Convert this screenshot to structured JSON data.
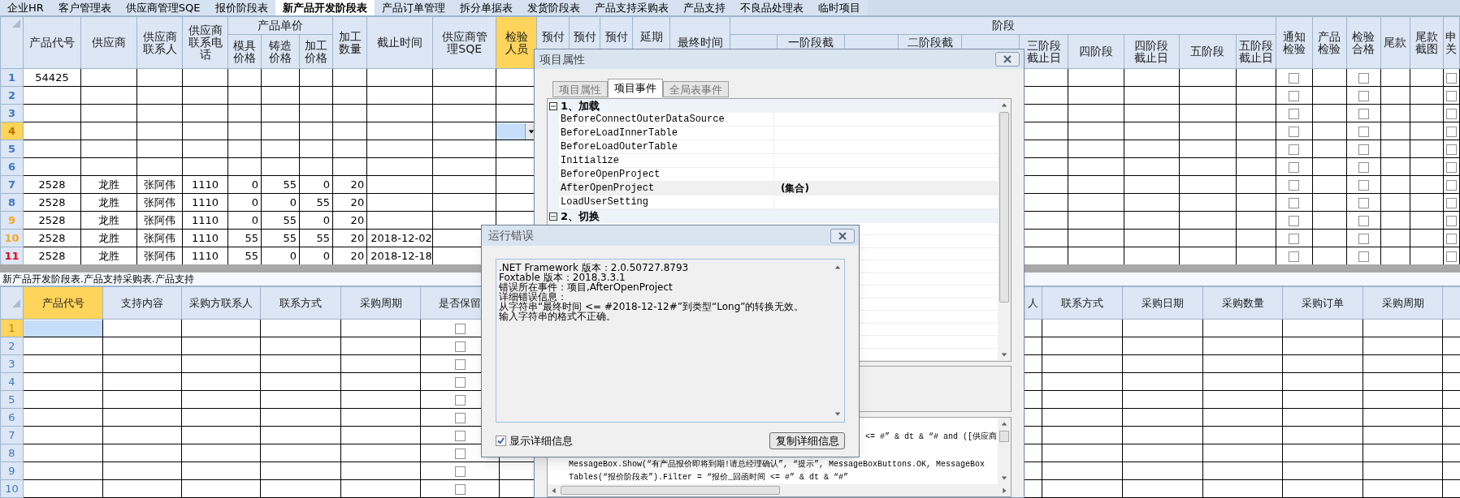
{
  "tabs": [
    {
      "label": "企业HR",
      "selected": false
    },
    {
      "label": "客户管理表",
      "selected": false
    },
    {
      "label": "供应商管理SQE",
      "selected": false
    },
    {
      "label": "报价阶段表",
      "selected": false
    },
    {
      "label": "新产品开发阶段表",
      "selected": true
    },
    {
      "label": "产品订单管理",
      "selected": false
    },
    {
      "label": "拆分单据表",
      "selected": false
    },
    {
      "label": "发货阶段表",
      "selected": false
    },
    {
      "label": "产品支持采购表",
      "selected": false
    },
    {
      "label": "产品支持",
      "selected": false
    },
    {
      "label": "不良品处理表",
      "selected": false
    },
    {
      "label": "临时项目",
      "selected": false
    }
  ],
  "upper_grid": {
    "columns": [
      {
        "label": "产品代号",
        "kind": "text",
        "selected": false
      },
      {
        "label": "供应商",
        "kind": "text",
        "selected": false
      },
      {
        "label": "供应商联系人",
        "kind": "text",
        "selected": false
      },
      {
        "label": "供应商联系电话",
        "kind": "text",
        "selected": false
      },
      {
        "label": "产品单价",
        "kind": "group",
        "children": [
          {
            "label": "模具价格",
            "kind": "number",
            "selected": false
          },
          {
            "label": "铸造价格",
            "kind": "number",
            "selected": false
          },
          {
            "label": "加工价格",
            "kind": "number",
            "selected": false
          }
        ]
      },
      {
        "label": "加工数量",
        "kind": "number",
        "selected": false
      },
      {
        "label": "截止时间",
        "kind": "date",
        "selected": false
      },
      {
        "label": "供应商管理SQE",
        "kind": "text",
        "selected": false
      },
      {
        "label": "检验人员",
        "kind": "text",
        "selected": true
      },
      {
        "label": "预付",
        "kind": "text",
        "selected": false
      },
      {
        "label": "预付",
        "kind": "text",
        "selected": false
      },
      {
        "label": "预付",
        "kind": "text",
        "selected": false
      },
      {
        "label": "延期",
        "kind": "text",
        "selected": false
      },
      {
        "label": "最终时间",
        "kind": "text",
        "selected": false
      },
      {
        "label": "阶段",
        "kind": "group",
        "children": [
          {
            "kind": "text",
            "selected": false
          },
          {
            "label": "一阶段截",
            "kind": "text",
            "selected": false
          },
          {
            "kind": "text",
            "selected": false
          },
          {
            "label": "二阶段截",
            "kind": "text",
            "selected": false
          },
          {
            "kind": "text",
            "selected": false
          },
          {
            "label": "三阶段截止日",
            "kind": "text",
            "selected": false
          },
          {
            "label": "四阶段",
            "kind": "text",
            "selected": false
          },
          {
            "label": "四阶段截止日",
            "kind": "text",
            "selected": false
          },
          {
            "label": "五阶段",
            "kind": "text",
            "selected": false
          },
          {
            "label": "五阶段截止日",
            "kind": "text",
            "selected": false
          }
        ]
      },
      {
        "label": "通知检验",
        "kind": "check",
        "selected": false
      },
      {
        "label": "产品检验",
        "kind": "text",
        "selected": false
      },
      {
        "label": "检验合格",
        "kind": "check",
        "selected": false
      },
      {
        "label": "尾款",
        "kind": "text",
        "selected": false
      },
      {
        "label": "尾款截图",
        "kind": "text",
        "selected": false
      },
      {
        "label": "申关",
        "kind": "check",
        "selected": false
      }
    ],
    "rows": [
      {
        "num": "1",
        "color": "#3c78c3",
        "selected": false,
        "cells": [
          "54425"
        ],
        "checks": [
          false,
          false,
          false
        ]
      },
      {
        "num": "2",
        "color": "#3c78c3",
        "selected": false,
        "checks": [
          false,
          false,
          false
        ]
      },
      {
        "num": "3",
        "color": "#3c78c3",
        "selected": false,
        "checks": [
          false,
          false,
          false
        ]
      },
      {
        "num": "4",
        "color": "#c07000",
        "selected": true,
        "checks": [
          false,
          false,
          false
        ]
      },
      {
        "num": "5",
        "color": "#3c78c3",
        "selected": false,
        "checks": [
          false,
          false,
          false
        ]
      },
      {
        "num": "6",
        "color": "#3c78c3",
        "selected": false,
        "checks": [
          false,
          false,
          false
        ]
      },
      {
        "num": "7",
        "color": "#3c78c3",
        "selected": false,
        "cells": [
          "2528",
          "龙胜",
          "张阿伟",
          "1110",
          "0",
          "55",
          "0",
          "20"
        ],
        "checks": [
          false,
          false,
          false
        ]
      },
      {
        "num": "8",
        "color": "#3c78c3",
        "selected": false,
        "cells": [
          "2528",
          "龙胜",
          "张阿伟",
          "1110",
          "0",
          "0",
          "55",
          "20"
        ],
        "checks": [
          false,
          false,
          false
        ]
      },
      {
        "num": "9",
        "color": "#f5a623",
        "selected": false,
        "cells": [
          "2528",
          "龙胜",
          "张阿伟",
          "1110",
          "0",
          "55",
          "0",
          "20"
        ],
        "checks": [
          false,
          false,
          false
        ]
      },
      {
        "num": "10",
        "color": "#f5a623",
        "selected": false,
        "cells": [
          "2528",
          "龙胜",
          "张阿伟",
          "1110",
          "55",
          "55",
          "55",
          "20",
          "2018-12-02"
        ],
        "checks": [
          false,
          false,
          false
        ]
      },
      {
        "num": "11",
        "color": "#e60012",
        "selected": false,
        "cells": [
          "2528",
          "龙胜",
          "张阿伟",
          "1110",
          "55",
          "0",
          "0",
          "20",
          "2018-12-18"
        ],
        "checks": [
          false,
          false,
          false
        ]
      }
    ]
  },
  "lower_grid": {
    "caption": "新产品开发阶段表.产品支持采购表.产品支持",
    "columns_left": [
      {
        "label": "产品代号",
        "kind": "text",
        "selected": true
      },
      {
        "label": "支持内容",
        "kind": "text",
        "selected": false
      },
      {
        "label": "采购方联系人",
        "kind": "text",
        "selected": false
      },
      {
        "label": "联系方式",
        "kind": "text",
        "selected": false
      },
      {
        "label": "采购周期",
        "kind": "text",
        "selected": false
      },
      {
        "label": "是否保留",
        "kind": "check",
        "selected": false
      }
    ],
    "columns_right": [
      {
        "label": "人",
        "kind": "tail",
        "selected": false
      },
      {
        "label": "联系方式",
        "kind": "text",
        "selected": false
      },
      {
        "label": "采购日期",
        "kind": "text",
        "selected": false
      },
      {
        "label": "采购数量",
        "kind": "text",
        "selected": false
      },
      {
        "label": "采购订单",
        "kind": "text",
        "selected": false
      },
      {
        "label": "采购周期",
        "kind": "text",
        "selected": false
      }
    ],
    "rows": [
      {
        "num": "1",
        "selected": true,
        "keep": false
      },
      {
        "num": "2",
        "selected": false,
        "keep": false
      },
      {
        "num": "3",
        "selected": false,
        "keep": false
      },
      {
        "num": "4",
        "selected": false,
        "keep": false
      },
      {
        "num": "5",
        "selected": false,
        "keep": false
      },
      {
        "num": "6",
        "selected": false,
        "keep": false
      },
      {
        "num": "7",
        "selected": false,
        "keep": false
      },
      {
        "num": "8",
        "selected": false,
        "keep": false
      },
      {
        "num": "9",
        "selected": false,
        "keep": false
      },
      {
        "num": "10",
        "selected": false,
        "keep": false
      }
    ]
  },
  "project_dialog": {
    "title": "项目属性",
    "tabs": [
      {
        "label": "项目属性",
        "selected": false
      },
      {
        "label": "项目事件",
        "selected": true
      },
      {
        "label": "全局表事件",
        "selected": false
      }
    ],
    "categories": [
      {
        "label": "1、加载",
        "expanded": true,
        "items": [
          {
            "name": "BeforeConnectOuterDataSource",
            "selected": false
          },
          {
            "name": "BeforeLoadInnerTable",
            "selected": false
          },
          {
            "name": "BeforeLoadOuterTable",
            "selected": false
          },
          {
            "name": "Initialize",
            "selected": false
          },
          {
            "name": "BeforeOpenProject",
            "selected": false
          },
          {
            "name": "AfterOpenProject",
            "value": "(集合)",
            "selected": true
          },
          {
            "name": "LoadUserSetting",
            "selected": false
          }
        ]
      },
      {
        "label": "2、切换",
        "expanded": true
      }
    ],
    "code_lines": [
      {
        "kind": "tail",
        "text": "<= #” & dt & “# and ([供应商"
      },
      {
        "kind": "full",
        "text": "MessageBox.Show(“有产品报价即将到期!请总经理确认”, “提示”, MessageBoxButtons.OK, MessageBox"
      },
      {
        "kind": "full",
        "text": "Tables(“报价阶段表”).Filter = “报价_回函时间 <= #” & dt & “#”"
      }
    ]
  },
  "error_dialog": {
    "title": "运行错误",
    "lines": [
      ".NET Framework 版本：2.0.50727.8793",
      "Foxtable 版本：2018.3.3.1",
      "错误所在事件：项目,AfterOpenProject",
      "详细错误信息：",
      "从字符串“最终时间 <= #2018-12-12#”到类型“Long”的转换无效。",
      "输入字符串的格式不正确。"
    ],
    "show_details": {
      "label": "显示详细信息",
      "checked": true
    },
    "copy_button": "复制详细信息"
  }
}
